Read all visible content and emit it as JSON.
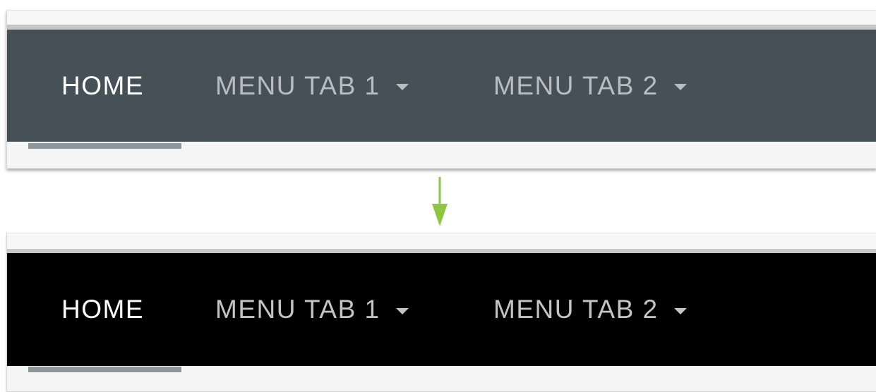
{
  "before": {
    "nav": {
      "items": [
        {
          "label": "HOME",
          "active": true,
          "dropdown": false
        },
        {
          "label": "MENU TAB 1",
          "active": false,
          "dropdown": true
        },
        {
          "label": "MENU TAB 2",
          "active": false,
          "dropdown": true
        }
      ],
      "background_color": "#465157"
    }
  },
  "after": {
    "nav": {
      "items": [
        {
          "label": "HOME",
          "active": true,
          "dropdown": false
        },
        {
          "label": "MENU TAB 1",
          "active": false,
          "dropdown": true
        },
        {
          "label": "MENU TAB 2",
          "active": false,
          "dropdown": true
        }
      ],
      "background_color": "#000000"
    }
  },
  "transition_arrow": {
    "icon": "arrow-down-icon",
    "color": "#8dc63f"
  },
  "active_indicator_color": "#8d969b"
}
